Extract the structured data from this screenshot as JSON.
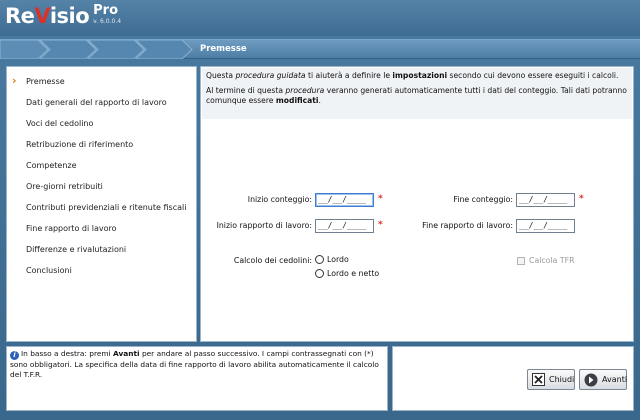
{
  "app": {
    "logo_part1": "Re",
    "logo_part2": "V",
    "logo_part3": "isio",
    "logo_pro": "Pro",
    "version": "v. 6.0.0.4"
  },
  "stepbar": {
    "title": "Premesse",
    "steps_total": 4
  },
  "nav": {
    "items": [
      {
        "label": "Premesse",
        "active": true
      },
      {
        "label": "Dati generali del rapporto di lavoro"
      },
      {
        "label": "Voci del cedolino"
      },
      {
        "label": "Retribuzione di riferimento"
      },
      {
        "label": "Competenze"
      },
      {
        "label": "Ore-giorni retribuiti"
      },
      {
        "label": "Contributi previdenziali e ritenute fiscali"
      },
      {
        "label": "Fine rapporto di lavoro"
      },
      {
        "label": "Differenze e rivalutazioni"
      },
      {
        "label": "Conclusioni"
      }
    ]
  },
  "intro": {
    "p1_a": "Questa ",
    "p1_b": "procedura guidata",
    "p1_c": " ti aiuterà a definire le ",
    "p1_d": "impostazioni",
    "p1_e": " secondo cui devono essere eseguiti i calcoli.",
    "p2_a": "Al termine di questa ",
    "p2_b": "procedura",
    "p2_c": "  veranno generati automaticamente tutti i dati del conteggio. Tali dati potranno comunque essere ",
    "p2_d": "modificati",
    "p2_e": "."
  },
  "form": {
    "inizio_conteggio_label": "Inizio conteggio:",
    "fine_conteggio_label": "Fine conteggio:",
    "inizio_rapporto_label": "Inizio rapporto di lavoro:",
    "fine_rapporto_label": "Fine rapporto di lavoro:",
    "date_placeholder": "__/__/____",
    "inizio_conteggio_value": "__/__/____",
    "fine_conteggio_value": "__/__/____",
    "inizio_rapporto_value": "__/__/____",
    "fine_rapporto_value": "__/__/____",
    "required_mark": "*",
    "calcolo_label": "Calcolo dei cedolini:",
    "option_lordo": "Lordo",
    "option_lordo_netto": "Lordo e netto",
    "calcola_tfr_label": "Calcola TFR"
  },
  "help": {
    "a": "In basso a destra: premi ",
    "b": "Avanti",
    "c": " per andare al passo successivo. I campi contrassegnati con (*) sono obbligatori. La specifica della data di fine rapporto di lavoro abilita automaticamente il calcolo del T.F.R."
  },
  "buttons": {
    "chiudi": "Chiudi",
    "avanti": "Avanti"
  },
  "colors": {
    "accent_red": "#d8322a",
    "frame_blue": "#3f6f95",
    "nav_arrow": "#e07a16"
  }
}
